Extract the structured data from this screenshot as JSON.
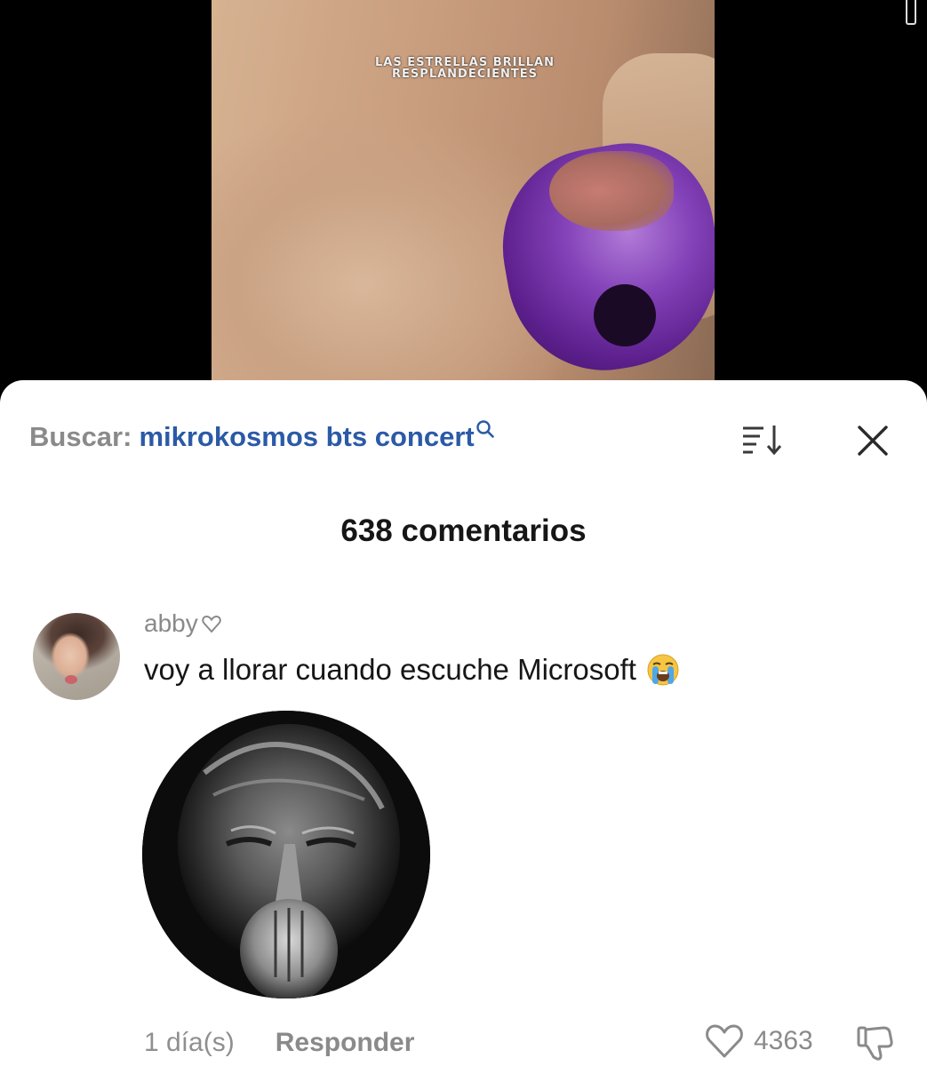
{
  "video": {
    "caption_line1": "LAS ESTRELLAS BRILLAN",
    "caption_line2": "RESPLANDECIENTES"
  },
  "search": {
    "prefix": "Buscar:",
    "query": "mikrokosmos bts concert",
    "icon": "search-icon"
  },
  "header": {
    "sort_icon": "sort-icon",
    "close_icon": "close-icon"
  },
  "comments": {
    "count_label": "638 comentarios",
    "items": [
      {
        "username": "abby",
        "username_icon": "heart-outline-icon",
        "text": "voy a llorar cuando escuche Microsoft",
        "emoji": "loudly-crying-face",
        "time": "1 día(s)",
        "reply_label": "Responder",
        "likes": "4363",
        "like_icon": "heart-outline-icon",
        "dislike_icon": "thumbs-down-icon"
      }
    ]
  },
  "colors": {
    "query": "#2b5aa6",
    "muted": "#8a8a8a",
    "text": "#161616",
    "sheet": "#ffffff"
  }
}
